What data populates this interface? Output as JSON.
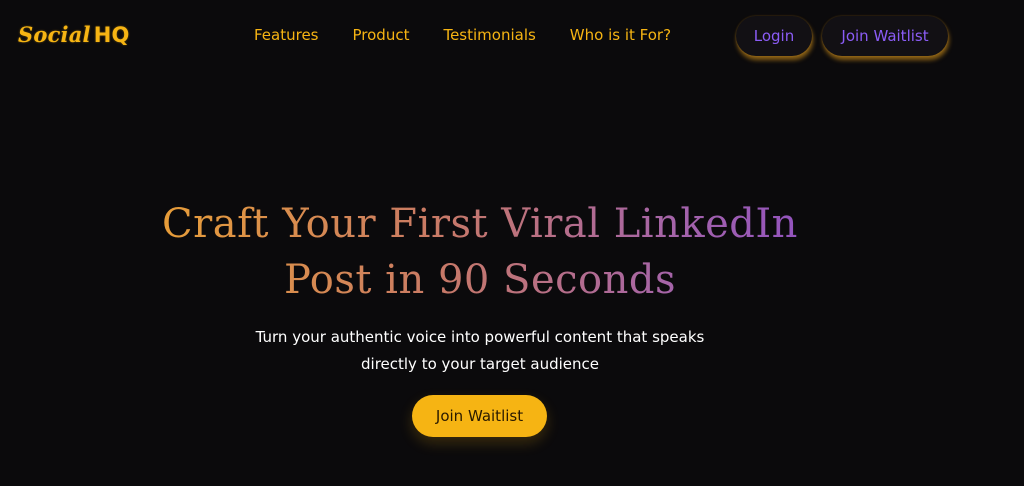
{
  "brand": {
    "logo_social": "Social",
    "logo_hq": "HQ"
  },
  "nav": {
    "links": [
      "Features",
      "Product",
      "Testimonials",
      "Who is it For?"
    ],
    "login_label": "Login",
    "join_label": "Join Waitlist"
  },
  "hero": {
    "title_line1": "Craft Your First Viral LinkedIn",
    "title_line2": "Post in 90 Seconds",
    "subtitle_line1": "Turn your authentic voice into powerful content that speaks",
    "subtitle_line2": "directly to your target audience",
    "cta_label": "Join Waitlist"
  },
  "colors": {
    "background": "#0b0a0c",
    "accent_yellow": "#f6b413",
    "accent_purple": "#8b5cf6",
    "text_white": "#ffffff"
  }
}
